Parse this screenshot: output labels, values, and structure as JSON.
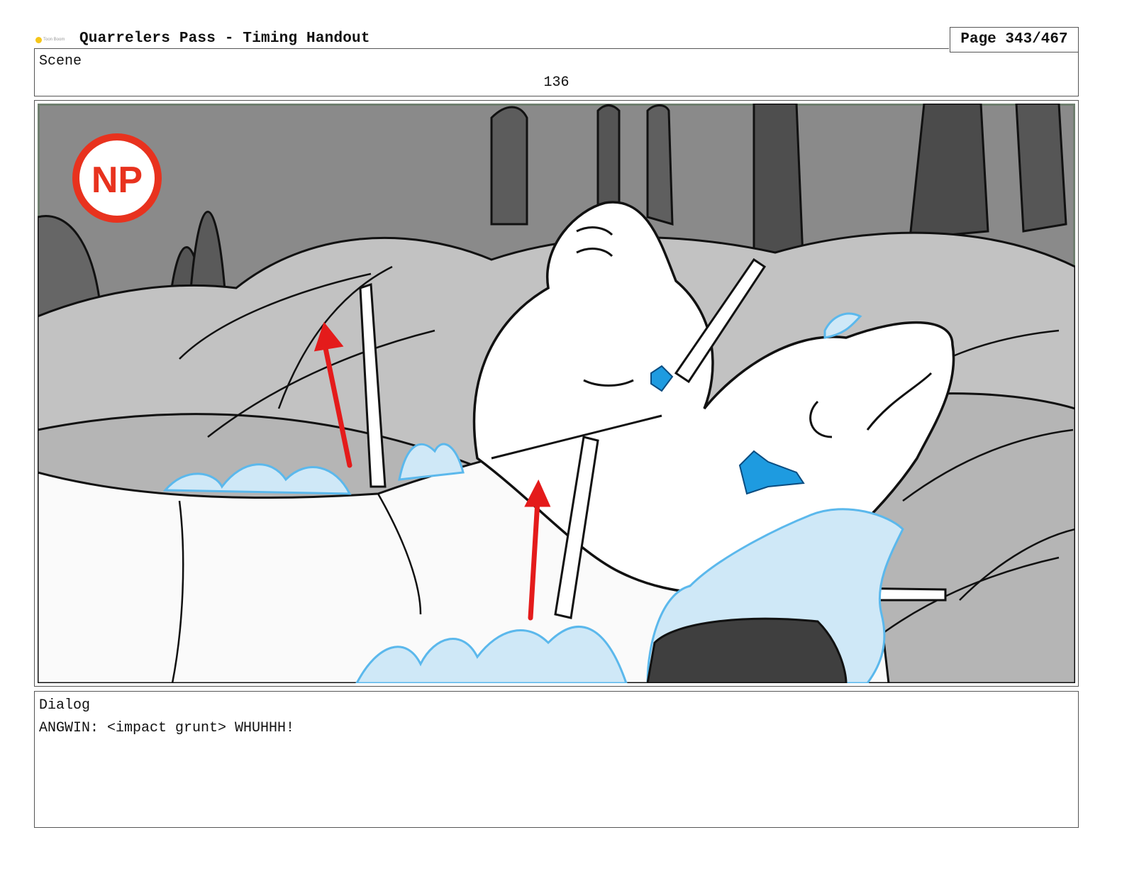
{
  "header": {
    "logo_text": "Toon Boom",
    "title": "Quarrelers Pass - Timing Handout",
    "page": "Page 343/467"
  },
  "scene": {
    "label": "Scene",
    "number": "136"
  },
  "panel": {
    "badge_text": "NP",
    "colors": {
      "badge": "#e8321e",
      "arrows": "#e41b1b",
      "splash": "#5bb8ec",
      "accent_blue": "#1e9be0",
      "background_grey": "#8c8c8c"
    }
  },
  "dialog": {
    "label": "Dialog",
    "text": "ANGWIN: <impact grunt> WHUHHH!"
  }
}
